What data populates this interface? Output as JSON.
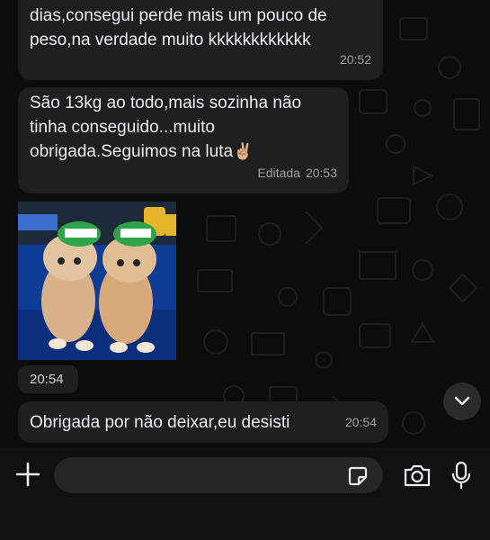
{
  "messages": [
    {
      "text": "dias,consegui perde mais um pouco de\npeso,na verdade muito kkkkkkkkkkkk",
      "time": "20:52"
    },
    {
      "text_main": "São 13kg ao todo,mais sozinha não\ntinha conseguido...muito\nobrigada.Seguimos na luta",
      "emoji": "✌🏼",
      "edited_label": "Editada",
      "time": "20:53"
    },
    {
      "image_name": "two kittens wearing green caps",
      "time": "20:54"
    },
    {
      "text": "Obrigada por não deixar,eu desisti",
      "time": "20:54"
    }
  ],
  "icons": {
    "scroll": "chevron-down-icon",
    "attach": "plus-icon",
    "sticker": "sticker-icon",
    "camera": "camera-icon",
    "mic": "mic-icon"
  },
  "input": {
    "placeholder": ""
  },
  "colors": {
    "background": "#0c0c0c",
    "bubble": "#1f1f1f",
    "text": "#e9edef",
    "meta": "#9aa0a3"
  }
}
